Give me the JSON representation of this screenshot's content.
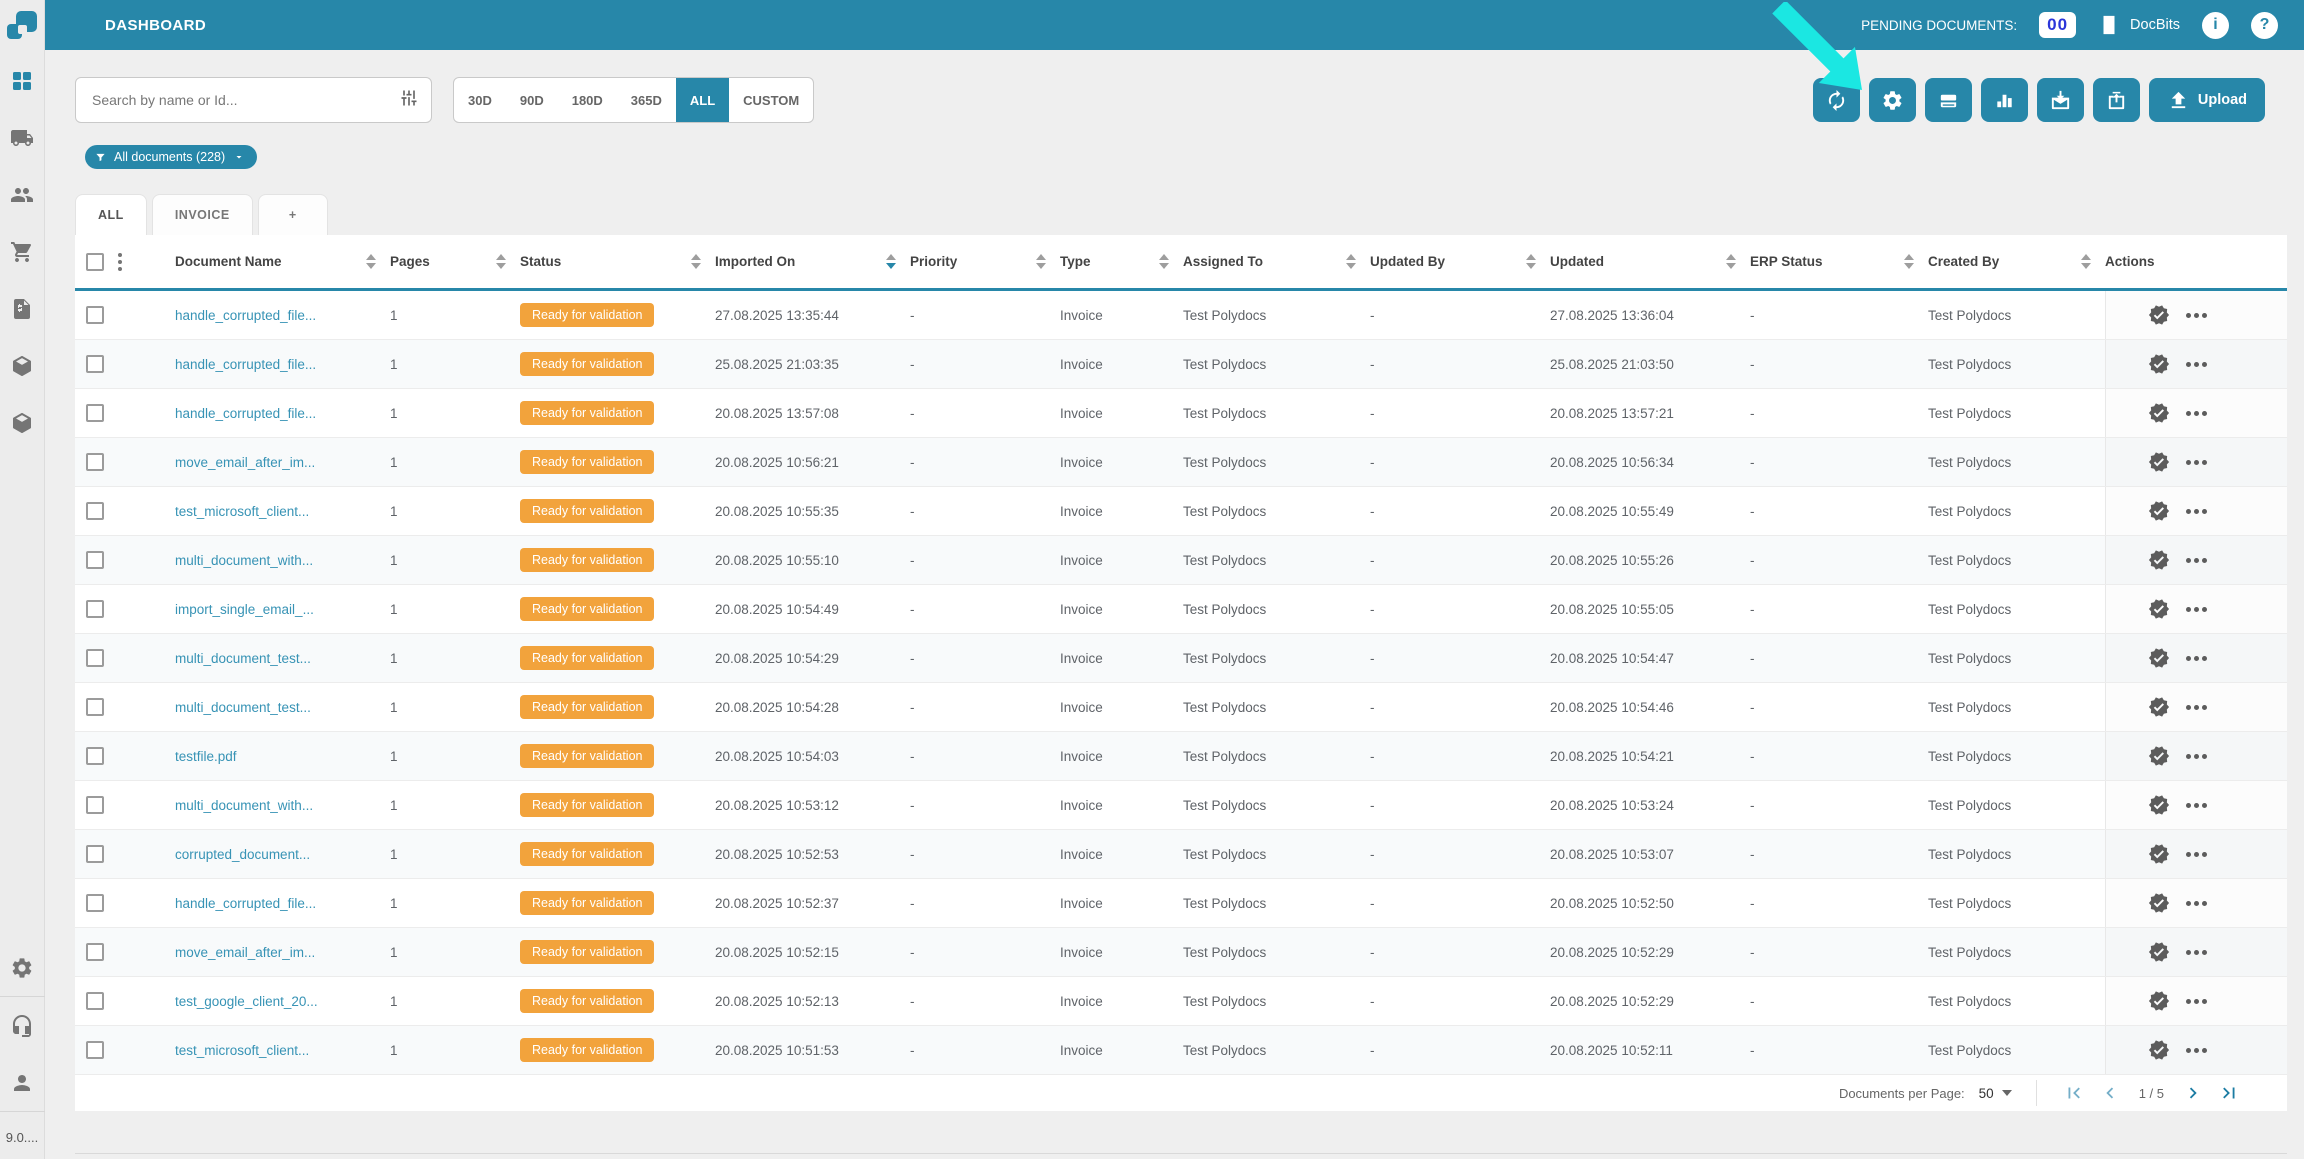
{
  "header": {
    "title": "DASHBOARD",
    "pending_label": "PENDING DOCUMENTS:",
    "pending_count": "00",
    "brand": "DocBits"
  },
  "filters": {
    "search_placeholder": "Search by name or Id...",
    "date_ranges": [
      {
        "label": "30D",
        "active": false
      },
      {
        "label": "90D",
        "active": false
      },
      {
        "label": "180D",
        "active": false
      },
      {
        "label": "365D",
        "active": false
      },
      {
        "label": "ALL",
        "active": true
      },
      {
        "label": "CUSTOM",
        "active": false
      }
    ],
    "chip_label": "All documents (228)",
    "tabs": [
      {
        "label": "ALL",
        "active": true
      },
      {
        "label": "INVOICE",
        "active": false
      },
      {
        "label": "+",
        "add": true
      }
    ]
  },
  "toolbar": {
    "upload_label": "Upload"
  },
  "table": {
    "columns": [
      {
        "label": "Document Name"
      },
      {
        "label": "Pages"
      },
      {
        "label": "Status"
      },
      {
        "label": "Imported On",
        "sort": "desc"
      },
      {
        "label": "Priority"
      },
      {
        "label": "Type"
      },
      {
        "label": "Assigned To"
      },
      {
        "label": "Updated By"
      },
      {
        "label": "Updated"
      },
      {
        "label": "ERP Status"
      },
      {
        "label": "Created By"
      },
      {
        "label": "Actions",
        "sortable": false
      }
    ],
    "rows": [
      {
        "name": "handle_corrupted_file...",
        "pages": "1",
        "status": "Ready for validation",
        "imported": "27.08.2025 13:35:44",
        "priority": "-",
        "type": "Invoice",
        "assigned": "Test Polydocs",
        "updated_by": "-",
        "updated": "27.08.2025 13:36:04",
        "erp": "-",
        "created_by": "Test Polydocs"
      },
      {
        "name": "handle_corrupted_file...",
        "pages": "1",
        "status": "Ready for validation",
        "imported": "25.08.2025 21:03:35",
        "priority": "-",
        "type": "Invoice",
        "assigned": "Test Polydocs",
        "updated_by": "-",
        "updated": "25.08.2025 21:03:50",
        "erp": "-",
        "created_by": "Test Polydocs"
      },
      {
        "name": "handle_corrupted_file...",
        "pages": "1",
        "status": "Ready for validation",
        "imported": "20.08.2025 13:57:08",
        "priority": "-",
        "type": "Invoice",
        "assigned": "Test Polydocs",
        "updated_by": "-",
        "updated": "20.08.2025 13:57:21",
        "erp": "-",
        "created_by": "Test Polydocs"
      },
      {
        "name": "move_email_after_im...",
        "pages": "1",
        "status": "Ready for validation",
        "imported": "20.08.2025 10:56:21",
        "priority": "-",
        "type": "Invoice",
        "assigned": "Test Polydocs",
        "updated_by": "-",
        "updated": "20.08.2025 10:56:34",
        "erp": "-",
        "created_by": "Test Polydocs"
      },
      {
        "name": "test_microsoft_client...",
        "pages": "1",
        "status": "Ready for validation",
        "imported": "20.08.2025 10:55:35",
        "priority": "-",
        "type": "Invoice",
        "assigned": "Test Polydocs",
        "updated_by": "-",
        "updated": "20.08.2025 10:55:49",
        "erp": "-",
        "created_by": "Test Polydocs"
      },
      {
        "name": "multi_document_with...",
        "pages": "1",
        "status": "Ready for validation",
        "imported": "20.08.2025 10:55:10",
        "priority": "-",
        "type": "Invoice",
        "assigned": "Test Polydocs",
        "updated_by": "-",
        "updated": "20.08.2025 10:55:26",
        "erp": "-",
        "created_by": "Test Polydocs"
      },
      {
        "name": "import_single_email_...",
        "pages": "1",
        "status": "Ready for validation",
        "imported": "20.08.2025 10:54:49",
        "priority": "-",
        "type": "Invoice",
        "assigned": "Test Polydocs",
        "updated_by": "-",
        "updated": "20.08.2025 10:55:05",
        "erp": "-",
        "created_by": "Test Polydocs"
      },
      {
        "name": "multi_document_test...",
        "pages": "1",
        "status": "Ready for validation",
        "imported": "20.08.2025 10:54:29",
        "priority": "-",
        "type": "Invoice",
        "assigned": "Test Polydocs",
        "updated_by": "-",
        "updated": "20.08.2025 10:54:47",
        "erp": "-",
        "created_by": "Test Polydocs"
      },
      {
        "name": "multi_document_test...",
        "pages": "1",
        "status": "Ready for validation",
        "imported": "20.08.2025 10:54:28",
        "priority": "-",
        "type": "Invoice",
        "assigned": "Test Polydocs",
        "updated_by": "-",
        "updated": "20.08.2025 10:54:46",
        "erp": "-",
        "created_by": "Test Polydocs"
      },
      {
        "name": "testfile.pdf",
        "pages": "1",
        "status": "Ready for validation",
        "imported": "20.08.2025 10:54:03",
        "priority": "-",
        "type": "Invoice",
        "assigned": "Test Polydocs",
        "updated_by": "-",
        "updated": "20.08.2025 10:54:21",
        "erp": "-",
        "created_by": "Test Polydocs"
      },
      {
        "name": "multi_document_with...",
        "pages": "1",
        "status": "Ready for validation",
        "imported": "20.08.2025 10:53:12",
        "priority": "-",
        "type": "Invoice",
        "assigned": "Test Polydocs",
        "updated_by": "-",
        "updated": "20.08.2025 10:53:24",
        "erp": "-",
        "created_by": "Test Polydocs"
      },
      {
        "name": "corrupted_document...",
        "pages": "1",
        "status": "Ready for validation",
        "imported": "20.08.2025 10:52:53",
        "priority": "-",
        "type": "Invoice",
        "assigned": "Test Polydocs",
        "updated_by": "-",
        "updated": "20.08.2025 10:53:07",
        "erp": "-",
        "created_by": "Test Polydocs"
      },
      {
        "name": "handle_corrupted_file...",
        "pages": "1",
        "status": "Ready for validation",
        "imported": "20.08.2025 10:52:37",
        "priority": "-",
        "type": "Invoice",
        "assigned": "Test Polydocs",
        "updated_by": "-",
        "updated": "20.08.2025 10:52:50",
        "erp": "-",
        "created_by": "Test Polydocs"
      },
      {
        "name": "move_email_after_im...",
        "pages": "1",
        "status": "Ready for validation",
        "imported": "20.08.2025 10:52:15",
        "priority": "-",
        "type": "Invoice",
        "assigned": "Test Polydocs",
        "updated_by": "-",
        "updated": "20.08.2025 10:52:29",
        "erp": "-",
        "created_by": "Test Polydocs"
      },
      {
        "name": "test_google_client_20...",
        "pages": "1",
        "status": "Ready for validation",
        "imported": "20.08.2025 10:52:13",
        "priority": "-",
        "type": "Invoice",
        "assigned": "Test Polydocs",
        "updated_by": "-",
        "updated": "20.08.2025 10:52:29",
        "erp": "-",
        "created_by": "Test Polydocs"
      },
      {
        "name": "test_microsoft_client...",
        "pages": "1",
        "status": "Ready for validation",
        "imported": "20.08.2025 10:51:53",
        "priority": "-",
        "type": "Invoice",
        "assigned": "Test Polydocs",
        "updated_by": "-",
        "updated": "20.08.2025 10:52:11",
        "erp": "-",
        "created_by": "Test Polydocs"
      }
    ]
  },
  "pagination": {
    "per_page_label": "Documents per Page:",
    "per_page": "50",
    "page_info": "1 / 5"
  },
  "sidebar": {
    "version": "9.0...."
  },
  "colors": {
    "accent": "#2787a9",
    "status_badge": "#f2a33c",
    "link": "#3793b5",
    "pending_count": "#2b36d9",
    "cursor_arrow": "#1be7e2"
  }
}
